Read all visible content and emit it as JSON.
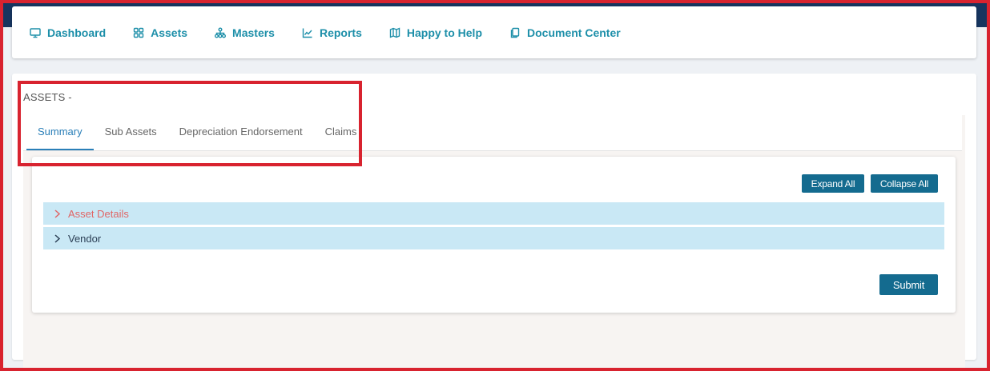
{
  "nav": {
    "items": [
      {
        "label": "Dashboard",
        "icon": "monitor-icon"
      },
      {
        "label": "Assets",
        "icon": "grid-icon"
      },
      {
        "label": "Masters",
        "icon": "hierarchy-icon"
      },
      {
        "label": "Reports",
        "icon": "chart-line-icon"
      },
      {
        "label": "Happy to Help",
        "icon": "map-icon"
      },
      {
        "label": "Document Center",
        "icon": "documents-icon"
      }
    ]
  },
  "page": {
    "title": "ASSETS -"
  },
  "tabs": [
    {
      "label": "Summary",
      "active": true
    },
    {
      "label": "Sub Assets",
      "active": false
    },
    {
      "label": "Depreciation Endorsement",
      "active": false
    },
    {
      "label": "Claims",
      "active": false
    }
  ],
  "toolbar": {
    "expand_label": "Expand All",
    "collapse_label": "Collapse All"
  },
  "accordion": [
    {
      "label": "Asset Details",
      "highlighted": true
    },
    {
      "label": "Vendor",
      "highlighted": false
    }
  ],
  "form": {
    "submit_label": "Submit"
  },
  "colors": {
    "accent": "#1d8fa9",
    "button": "#146b8f",
    "accordion_bg": "#c9e8f5",
    "highlight_text": "#e06666",
    "annotation": "#d8232f"
  }
}
